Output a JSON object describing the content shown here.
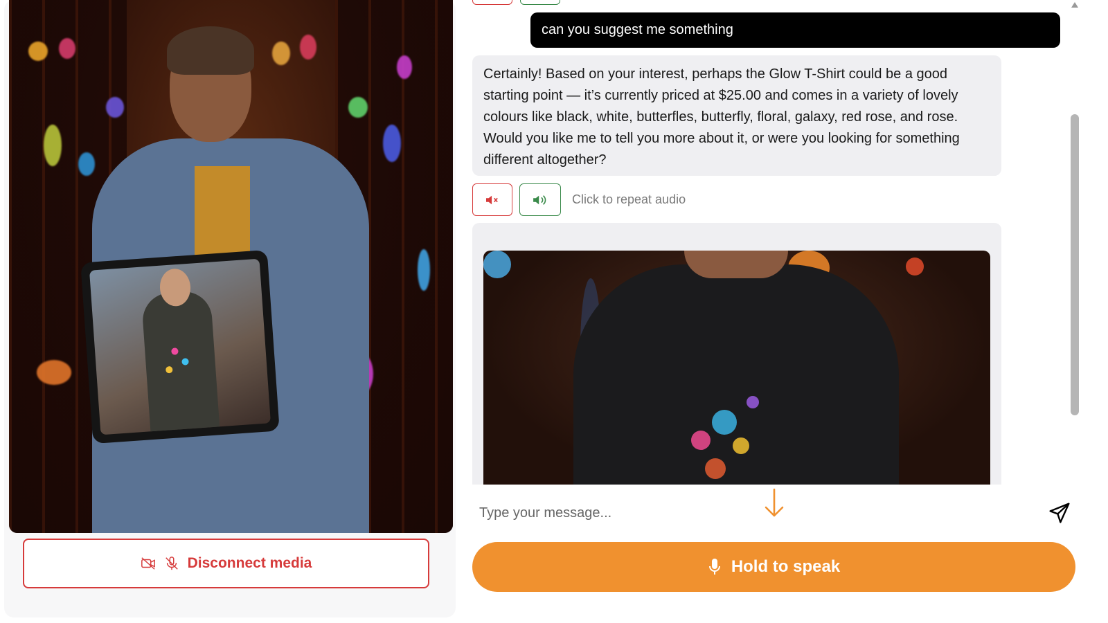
{
  "chat": {
    "user_message": "can you suggest me something",
    "bot_message": "Certainly! Based on your interest, perhaps the Glow T-Shirt could be a good starting point — it’s currently priced at $25.00 and comes in a variety of lovely colours like black, white, butterfles, butterfly, floral, galaxy, red rose, and rose. Would you like me to tell you more about it, or were you looking for something different altogether?",
    "repeat_audio_label": "Click to repeat audio"
  },
  "input": {
    "placeholder": "Type your message..."
  },
  "media": {
    "disconnect_label": "Disconnect media"
  },
  "speak": {
    "label": "Hold to speak"
  },
  "colors": {
    "accent_orange": "#f0912f",
    "danger_red": "#d63a3a",
    "success_green": "#3a8a4a",
    "user_bubble": "#000000",
    "bot_bubble": "#efeff2"
  },
  "icons": {
    "mute": "speaker-mute-icon",
    "play": "speaker-play-icon",
    "camera_off": "camera-off-icon",
    "mic_off": "mic-off-icon",
    "send": "send-icon",
    "mic": "mic-icon",
    "arrow": "arrow-down-icon"
  }
}
